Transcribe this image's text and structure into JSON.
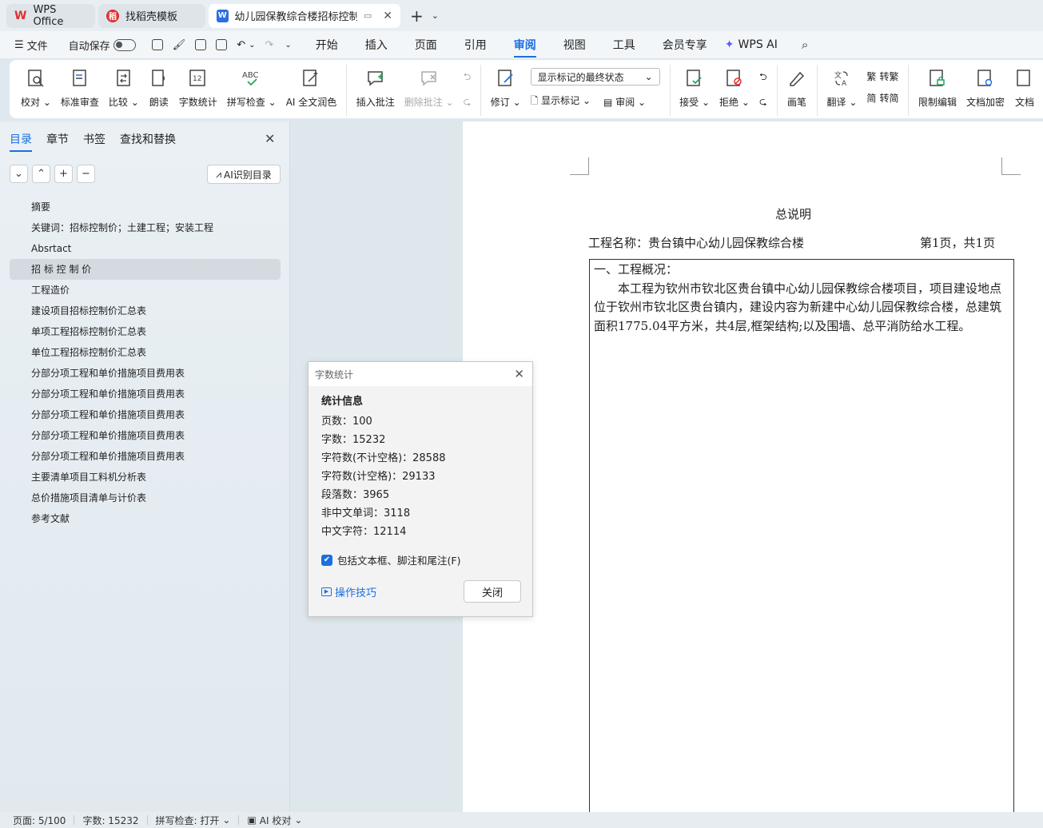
{
  "tabs": [
    {
      "label": "WPS Office",
      "icon": "wps-logo-icon",
      "color": "#e0302f"
    },
    {
      "label": "找稻壳模板",
      "icon": "docer-icon",
      "color": "#e0302f"
    },
    {
      "label": "幼儿园保教综合楼招标控制价",
      "icon": "word-doc-icon",
      "color": "#2a6fe0",
      "active": true
    }
  ],
  "menu": {
    "file": "文件",
    "autosave": "自动保存",
    "tabs": [
      "开始",
      "插入",
      "页面",
      "引用",
      "审阅",
      "视图",
      "工具",
      "会员专享"
    ],
    "active_tab": "审阅",
    "wps_ai": "WPS AI"
  },
  "ribbon": {
    "proofread": "校对",
    "standard_review": "标准审查",
    "compare": "比较",
    "read_aloud": "朗读",
    "word_count": "字数统计",
    "spell_check": "拼写检查",
    "ai_polish": "AI 全文润色",
    "insert_comment": "插入批注",
    "delete_comment": "删除批注",
    "revise": "修订",
    "markup_select": "显示标记的最终状态",
    "show_markup": "显示标记",
    "review": "审阅",
    "accept": "接受",
    "reject": "拒绝",
    "pen": "画笔",
    "translate": "翻译",
    "to_traditional": "转繁",
    "to_simplified": "转简",
    "restrict_edit": "限制编辑",
    "encrypt": "文档加密",
    "doc_more": "文档"
  },
  "nav": {
    "tabs": [
      "目录",
      "章节",
      "书签",
      "查找和替换"
    ],
    "ai_toc": "AI识别目录",
    "toc_items": [
      "摘要",
      "关键词：招标控制价；土建工程；安装工程",
      "Absrtact",
      "招 标 控 制 价",
      "工程造价",
      "建设项目招标控制价汇总表",
      "单项工程招标控制价汇总表",
      "单位工程招标控制价汇总表",
      "分部分项工程和单价措施项目费用表",
      "分部分项工程和单价措施项目费用表",
      "分部分项工程和单价措施项目费用表",
      "分部分项工程和单价措施项目费用表",
      "分部分项工程和单价措施项目费用表",
      "主要清单项目工料机分析表",
      "总价措施项目清单与计价表",
      "参考文献"
    ],
    "active_index": 3
  },
  "document": {
    "title": "总说明",
    "project": "工程名称：贵台镇中心幼儿园保教综合楼",
    "page_info": "第1页，共1页",
    "section": "一、工程概况：",
    "paragraph": "本工程为钦州市钦北区贵台镇中心幼儿园保教综合楼项目，项目建设地点位于钦州市钦北区贵台镇内，建设内容为新建中心幼儿园保教综合楼，总建筑面积1775.04平方米，共4层,框架结构;以及围墙、总平消防给水工程。"
  },
  "dialog": {
    "title": "字数统计",
    "heading": "统计信息",
    "rows": [
      "页数：100",
      "字数：15232",
      "字符数(不计空格)：28588",
      "字符数(计空格)：29133",
      "段落数：3965",
      "非中文单词：3118",
      "中文字符：12114"
    ],
    "checkbox_label": "包括文本框、脚注和尾注(F)",
    "checkbox_checked": true,
    "tips": "操作技巧",
    "close": "关闭"
  },
  "status": {
    "page": "页面: 5/100",
    "words": "字数: 15232",
    "spell": "拼写检查: 打开",
    "ai_check": "AI 校对"
  }
}
